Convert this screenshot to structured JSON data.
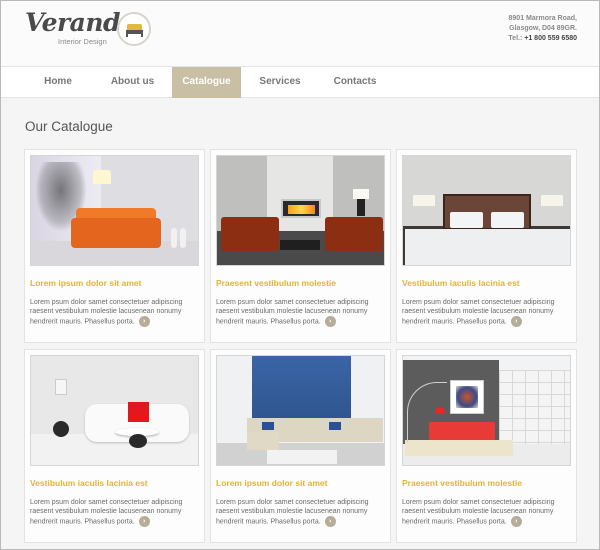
{
  "brand": {
    "name": "Veranda",
    "tagline": "Interior Design",
    "logo_icon": "bed-icon"
  },
  "contact": {
    "address_line1": "8901 Marmora Road,",
    "address_line2": "Glasgow, D04 89GR.",
    "tel_label": "Tel.:",
    "tel_number": "+1 800 559 6580"
  },
  "nav": {
    "items": [
      {
        "label": "Home",
        "active": false
      },
      {
        "label": "About us",
        "active": false
      },
      {
        "label": "Catalogue",
        "active": true
      },
      {
        "label": "Services",
        "active": false
      },
      {
        "label": "Contacts",
        "active": false
      }
    ]
  },
  "page": {
    "title": "Our Catalogue"
  },
  "catalogue": {
    "items": [
      {
        "title": "Lorem ipsum dolor sit amet",
        "text": "Lorem psum dolor samet consectetuer adipiscing raesent vestibulum molestie lacusenean nonumy hendrerit mauris. Phasellus porta.",
        "image": "orange sofa with bare tree and lamp"
      },
      {
        "title": "Praesent vestibulum molestie",
        "text": "Lorem psum dolor samet consectetuer adipiscing raesent vestibulum molestie lacusenean nonumy hendrerit mauris. Phasellus porta.",
        "image": "brown leather armchairs by fireplace"
      },
      {
        "title": "Vestibulum iaculis lacinia est",
        "text": "Lorem psum dolor samet consectetuer adipiscing raesent vestibulum molestie lacusenean nonumy hendrerit mauris. Phasellus porta.",
        "image": "bedroom with white bed and bedside lamps"
      },
      {
        "title": "Vestibulum iaculis lacinia est",
        "text": "Lorem psum dolor samet consectetuer adipiscing raesent vestibulum molestie lacusenean nonumy hendrerit mauris. Phasellus porta.",
        "image": "white sofa with red pillow"
      },
      {
        "title": "Lorem ipsum dolor sit amet",
        "text": "Lorem psum dolor samet consectetuer adipiscing raesent vestibulum molestie lacusenean nonumy hendrerit mauris. Phasellus porta.",
        "image": "beige corner sofa with blue wall"
      },
      {
        "title": "Praesent vestibulum molestie",
        "text": "Lorem psum dolor samet consectetuer adipiscing raesent vestibulum molestie lacusenean nonumy hendrerit mauris. Phasellus porta.",
        "image": "red sofa with arc lamp and painting"
      }
    ],
    "more_icon": "arrow-right-circle-icon"
  },
  "colors": {
    "accent": "#c9bfa4",
    "title_gold": "#e2b33a",
    "more_button": "#b5ad98"
  }
}
